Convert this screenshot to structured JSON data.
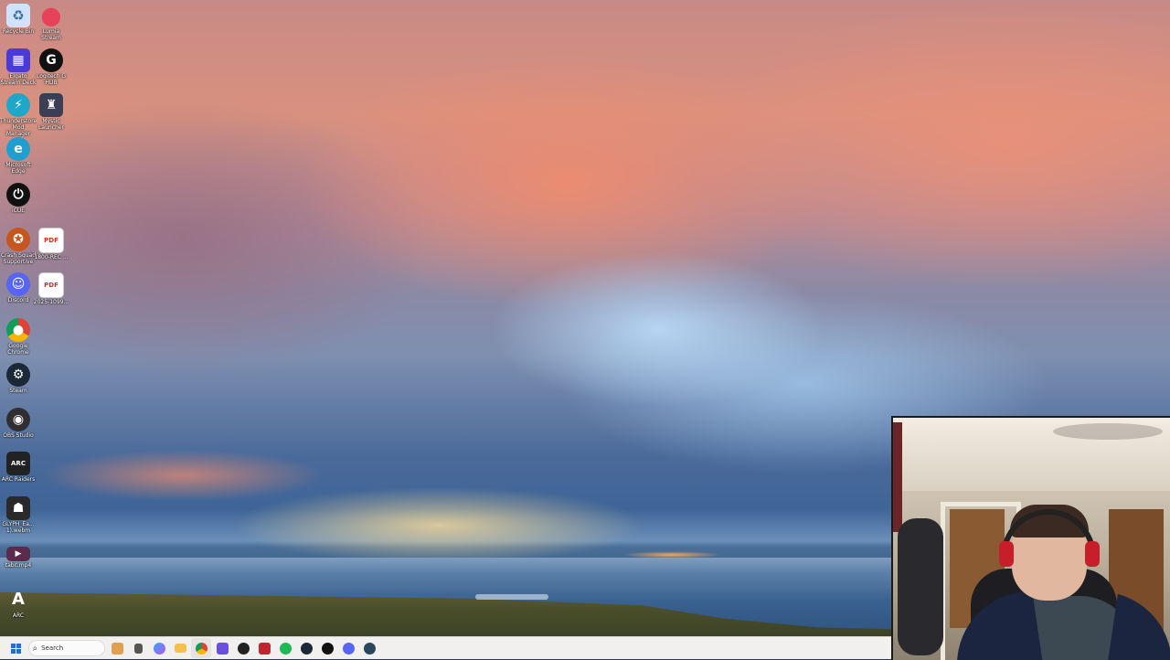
{
  "desktop": {
    "icons": [
      {
        "label": "Recycle Bin",
        "icon": "recycle-bin-icon",
        "color": "#cfe3ff"
      },
      {
        "label": "Lumia Stream",
        "icon": "lumia-pin-icon",
        "color": "#e8425a"
      },
      {
        "label": "Elgato Stream Deck",
        "icon": "stream-deck-icon",
        "color": "#4a3bd8"
      },
      {
        "label": "Logitech G HUB",
        "icon": "logitech-g-icon",
        "color": "#111111"
      },
      {
        "label": "Thunderstore Mod Manager",
        "icon": "thunderstore-icon",
        "color": "#1fa7c9"
      },
      {
        "label": "Mystic Launcher",
        "icon": "mystic-launcher-icon",
        "color": "#3a3f56"
      },
      {
        "label": "Microsoft Edge",
        "icon": "edge-icon",
        "color": "#1f9fd1"
      },
      {
        "label": "iCUE",
        "icon": "icue-icon",
        "color": "#111111"
      },
      {
        "label": "Crash Squad Supportive",
        "icon": "crash-squad-icon",
        "color": "#c7561e"
      },
      {
        "label": "1800-REC ...",
        "icon": "pdf-icon",
        "color": "#d93025"
      },
      {
        "label": "Discord",
        "icon": "discord-icon",
        "color": "#5865f2"
      },
      {
        "label": "2025-1099...",
        "icon": "pdf-icon",
        "color": "#d93025"
      },
      {
        "label": "Google Chrome",
        "icon": "chrome-icon",
        "color": "#db4437"
      },
      {
        "label": "Steam",
        "icon": "steam-icon",
        "color": "#1b2838"
      },
      {
        "label": "OBS Studio",
        "icon": "obs-icon",
        "color": "#302e31"
      },
      {
        "label": "ARC Raiders",
        "icon": "arc-raiders-icon",
        "color": "#222222"
      },
      {
        "label": "GLYPH_Ea... 1).webm",
        "icon": "video-file-icon",
        "color": "#2a2a2a"
      },
      {
        "label": "tabc.mp4",
        "icon": "video-thumb-icon",
        "color": "#5a2b4a"
      },
      {
        "label": "ARC",
        "icon": "arc-letter-icon",
        "color": "#1a1a1a"
      }
    ]
  },
  "taskbar": {
    "search_placeholder": "Search",
    "pinned": [
      {
        "name": "task-view-icon",
        "color": "#e0a050"
      },
      {
        "name": "file-manager-icon",
        "color": "#555555"
      },
      {
        "name": "copilot-icon",
        "color": "#7a5ce6"
      },
      {
        "name": "file-explorer-icon",
        "color": "#f2c14e"
      },
      {
        "name": "chrome-icon",
        "color": "#db4437"
      },
      {
        "name": "stream-deck-icon",
        "color": "#6a4fe0"
      },
      {
        "name": "gaming-app-icon",
        "color": "#222222"
      },
      {
        "name": "media-app-icon",
        "color": "#c1262f"
      },
      {
        "name": "spotify-icon",
        "color": "#1db954"
      },
      {
        "name": "steam-icon",
        "color": "#1b2838"
      },
      {
        "name": "logitech-g-icon",
        "color": "#111111"
      },
      {
        "name": "discord-icon",
        "color": "#5865f2"
      },
      {
        "name": "steam-alt-icon",
        "color": "#2a475e"
      }
    ]
  }
}
